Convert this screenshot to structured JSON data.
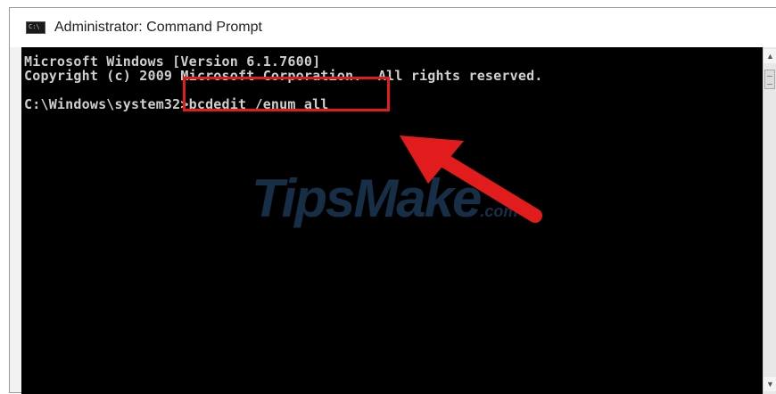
{
  "window": {
    "title": "Administrator: Command Prompt",
    "icon": "cmd-icon",
    "icon_text": "C:\\"
  },
  "console": {
    "lines": [
      "Microsoft Windows [Version 6.1.7600]",
      "Copyright (c) 2009 Microsoft Corporation.  All rights reserved.",
      "",
      "C:\\Windows\\system32>bcdedit /enum all"
    ],
    "text_color": "#cfcfcf",
    "background_color": "#000000"
  },
  "annotations": {
    "highlight_color": "#e21c1c",
    "arrow_color": "#e21c1c"
  },
  "watermark": {
    "brand": "TipsMake",
    "suffix": ".com"
  }
}
